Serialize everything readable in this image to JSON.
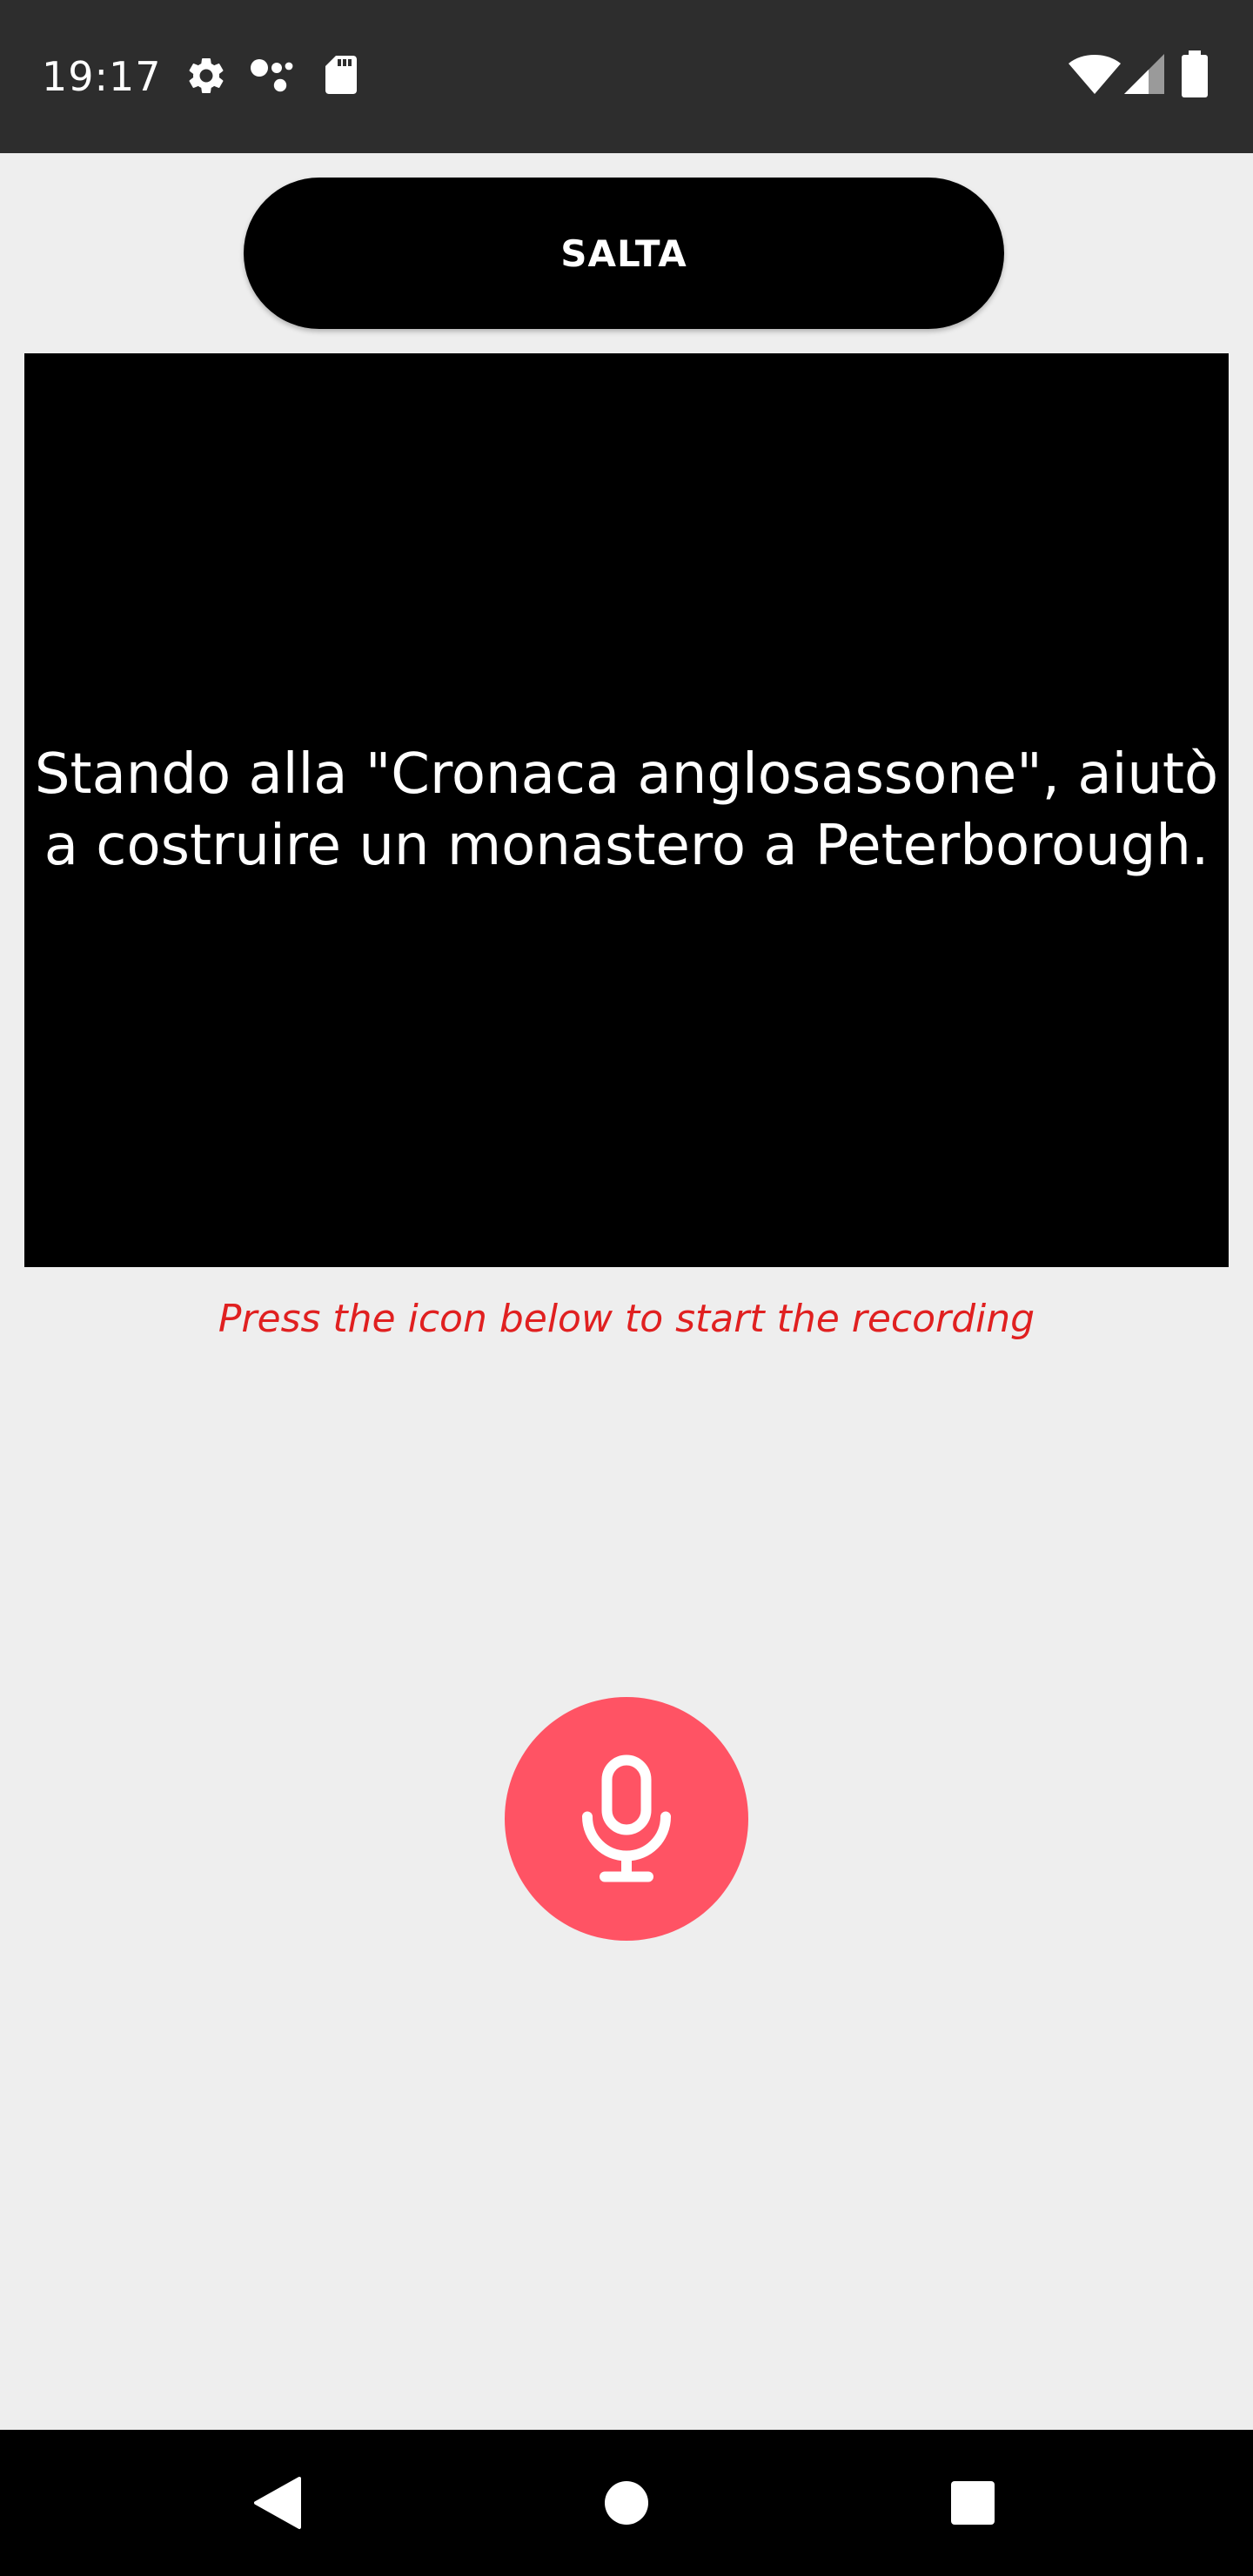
{
  "status_bar": {
    "time": "19:17",
    "icons_left": [
      "settings-icon",
      "assistant-icon",
      "sd-card-icon"
    ],
    "icons_right": [
      "wifi-icon",
      "cell-signal-icon",
      "battery-icon"
    ]
  },
  "skip_button": {
    "label": "SALTA"
  },
  "prompt": {
    "text": "Stando alla \"Cronaca anglosassone\", aiutò a costruire un monastero a Peterborough."
  },
  "hint": {
    "text": "Press the icon below to start the recording",
    "color": "#e02020"
  },
  "mic_button": {
    "icon": "microphone-icon",
    "color": "#ff5364"
  },
  "nav_bar": {
    "buttons": [
      "back-icon",
      "home-icon",
      "recents-icon"
    ]
  },
  "colors": {
    "status_bar_bg": "#2d2d2d",
    "background": "#eeeeee",
    "panel_bg": "#000000"
  }
}
